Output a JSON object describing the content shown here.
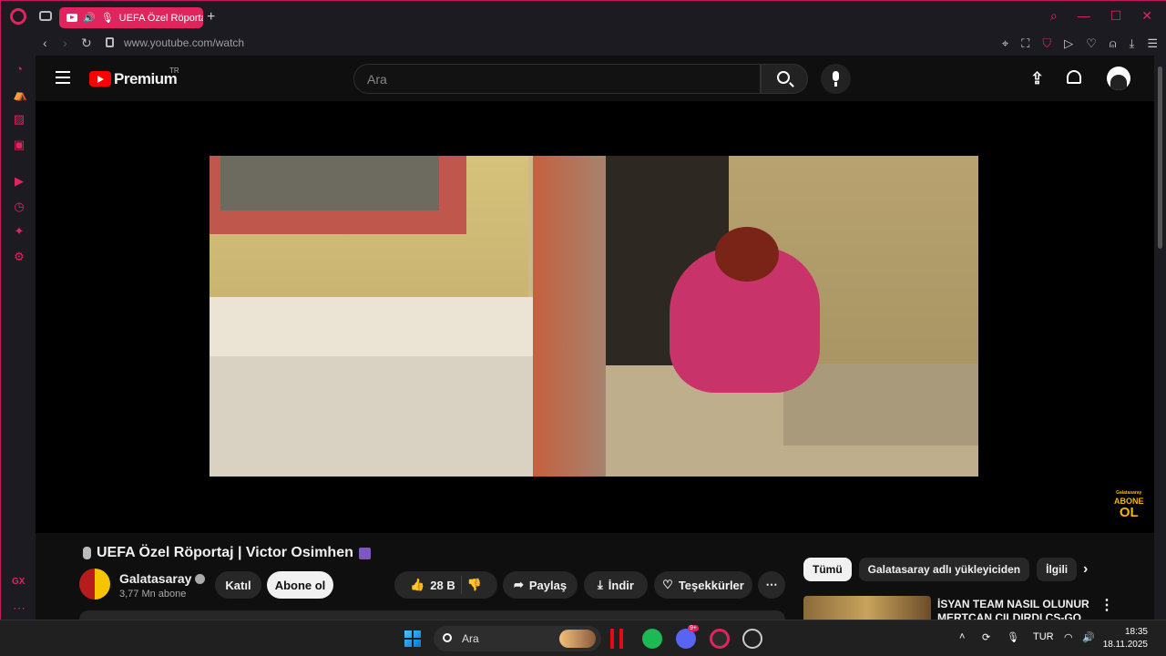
{
  "browser": {
    "tab_title": "UEFA Özel Röportaj",
    "url_host": "www.youtube.com",
    "url_path": "/watch",
    "accent": "#e0245e"
  },
  "youtube": {
    "logo_text": "Premium",
    "region": "TR",
    "search_placeholder": "Ara",
    "video_title": "UEFA Özel Röportaj | Victor Osimhen",
    "channel_name": "Galatasaray",
    "subscribers": "3,77 Mn abone",
    "join_label": "Katıl",
    "subscribe_label": "Abone ol",
    "likes": "28 B",
    "share_label": "Paylaş",
    "download_label": "İndir",
    "thanks_label": "Teşekkürler",
    "overlay_small": "Galatasaray",
    "overlay_top": "ABONE",
    "overlay_bottom": "OL",
    "chips": [
      "Tümü",
      "Galatasaray adlı yükleyiciden",
      "İlgili"
    ],
    "rec_title_line1": "İSYAN TEAM NASIL OLUNUR !!",
    "rec_title_line2": "MERTCAN ÇILDIRDI CS-GO"
  },
  "taskbar": {
    "search_placeholder": "Ara",
    "language": "TUR",
    "time": "18:35",
    "date": "18.11.2025",
    "discord_badge": "9+"
  }
}
